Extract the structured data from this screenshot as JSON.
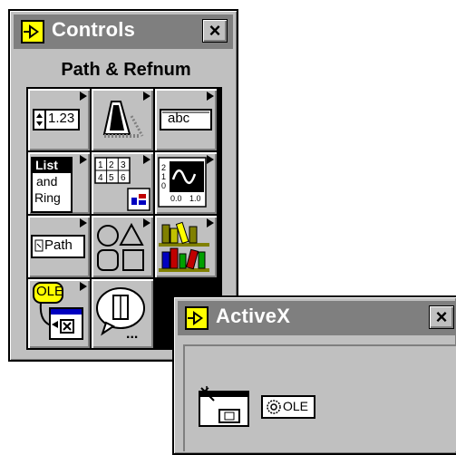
{
  "controls_window": {
    "title": "Controls",
    "close_label": "×",
    "palette_name": "Path & Refnum",
    "tiles": [
      {
        "name": "Numeric",
        "text": "1.23"
      },
      {
        "name": "Boolean",
        "text": ""
      },
      {
        "name": "String",
        "text": "abc"
      },
      {
        "name": "List and Ring",
        "line1": "List",
        "line2": "and",
        "line3": "Ring"
      },
      {
        "name": "Array and Cluster",
        "text": ""
      },
      {
        "name": "Graph",
        "ticks_y": [
          "2",
          "1",
          "0"
        ],
        "ticks_x": [
          "0.0",
          "1.0"
        ]
      },
      {
        "name": "Path and Refnum",
        "text": "Path"
      },
      {
        "name": "Decorations",
        "text": ""
      },
      {
        "name": "Select a Control",
        "text": ""
      },
      {
        "name": "ActiveX",
        "text": "OLE"
      },
      {
        "name": "User Controls",
        "text": "..."
      }
    ]
  },
  "activex_window": {
    "title": "ActiveX",
    "close_label": "×",
    "items": [
      {
        "name": "ActiveX Container"
      },
      {
        "name": "Automation Refnum",
        "text": "OLE"
      }
    ]
  },
  "colors": {
    "window_bg": "#c0c0c0",
    "titlebar": "#7f7f7f",
    "logo_yellow": "#ffff00"
  }
}
